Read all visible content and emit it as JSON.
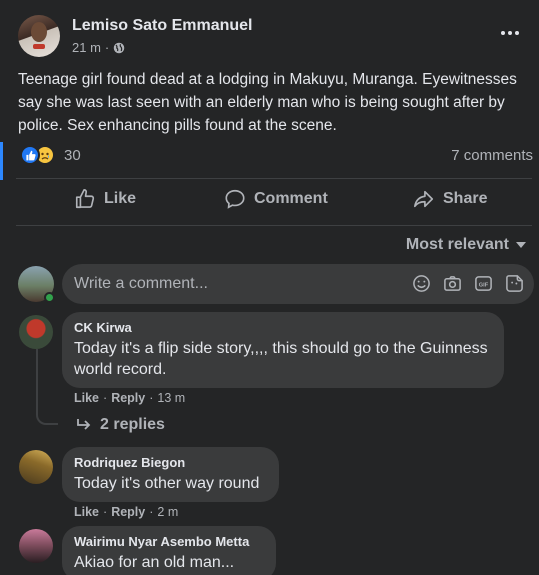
{
  "post": {
    "author": "Lemiso Sato Emmanuel",
    "time": "21 m",
    "privacy_icon": "globe-icon",
    "text": "Teenage girl found dead at a lodging in Makuyu, Muranga. Eyewitnesses say she was last seen with an elderly man who is being sought after by police. Sex enhancing pills found at the scene.",
    "reaction_count": "30",
    "comment_count": "7 comments"
  },
  "actions": {
    "like": "Like",
    "comment": "Comment",
    "share": "Share"
  },
  "sort": {
    "label": "Most relevant"
  },
  "composer": {
    "placeholder": "Write a comment..."
  },
  "comments": [
    {
      "author": "CK Kirwa",
      "text": "Today it's a flip side story,,,, this should go to the Guinness world record.",
      "like": "Like",
      "reply": "Reply",
      "time": "13 m",
      "replies": "2 replies"
    },
    {
      "author": "Rodriquez Biegon",
      "text": "Today it's other way round",
      "like": "Like",
      "reply": "Reply",
      "time": "2 m"
    },
    {
      "author": "Wairimu Nyar Asembo Metta",
      "text": "Akiao for an old man..."
    }
  ],
  "colors": {
    "background": "#242526",
    "bubble": "#3a3b3c",
    "accent": "#2d88ff",
    "like_reaction": "#2078f4",
    "sad_reaction": "#f7c540",
    "online": "#31a24c"
  }
}
